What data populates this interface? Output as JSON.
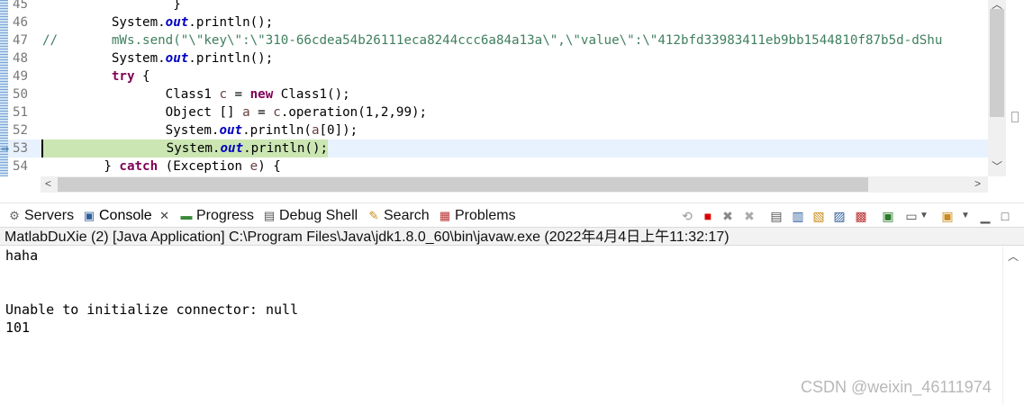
{
  "editor": {
    "lines": [
      {
        "num": "45",
        "segments": [
          {
            "t": "                 }",
            "c": ""
          }
        ]
      },
      {
        "num": "46",
        "segments": [
          {
            "t": "         System.",
            "c": ""
          },
          {
            "t": "out",
            "c": "fld"
          },
          {
            "t": ".println();",
            "c": ""
          }
        ]
      },
      {
        "num": "47",
        "segments": [
          {
            "t": "//       mWs.send(\"\\\"key\\\":\\\"310-66cdea54b26111eca8244ccc6a84a13a\\\",\\\"value\\\":\\\"412bfd33983411eb9bb1544810f87b5d-dShu",
            "c": "cm"
          }
        ]
      },
      {
        "num": "48",
        "segments": [
          {
            "t": "         System.",
            "c": ""
          },
          {
            "t": "out",
            "c": "fld"
          },
          {
            "t": ".println();",
            "c": ""
          }
        ]
      },
      {
        "num": "49",
        "segments": [
          {
            "t": "         ",
            "c": ""
          },
          {
            "t": "try",
            "c": "kw"
          },
          {
            "t": " {",
            "c": ""
          }
        ]
      },
      {
        "num": "50",
        "segments": [
          {
            "t": "                Class1 ",
            "c": ""
          },
          {
            "t": "c",
            "c": "var"
          },
          {
            "t": " = ",
            "c": ""
          },
          {
            "t": "new",
            "c": "kw"
          },
          {
            "t": " Class1();",
            "c": ""
          }
        ]
      },
      {
        "num": "51",
        "segments": [
          {
            "t": "                Object [] ",
            "c": ""
          },
          {
            "t": "a",
            "c": "var"
          },
          {
            "t": " = ",
            "c": ""
          },
          {
            "t": "c",
            "c": "var"
          },
          {
            "t": ".operation(1,2,99);",
            "c": ""
          }
        ]
      },
      {
        "num": "52",
        "segments": [
          {
            "t": "                System.",
            "c": ""
          },
          {
            "t": "out",
            "c": "fld"
          },
          {
            "t": ".println(",
            "c": ""
          },
          {
            "t": "a",
            "c": "var"
          },
          {
            "t": "[0]);",
            "c": ""
          }
        ]
      },
      {
        "num": "53",
        "current": true,
        "segments": [
          {
            "t": "                System.",
            "c": ""
          },
          {
            "t": "out",
            "c": "fld"
          },
          {
            "t": ".println();",
            "c": ""
          }
        ]
      },
      {
        "num": "54",
        "segments": [
          {
            "t": "        } ",
            "c": ""
          },
          {
            "t": "catch",
            "c": "kw"
          },
          {
            "t": " (Exception ",
            "c": ""
          },
          {
            "t": "e",
            "c": "var"
          },
          {
            "t": ") {",
            "c": ""
          }
        ]
      }
    ]
  },
  "tabs": [
    {
      "label": "Servers",
      "icon": "servers-icon",
      "glyph": "⚙"
    },
    {
      "label": "Console",
      "icon": "console-icon",
      "glyph": "▣",
      "active": true,
      "closable": true
    },
    {
      "label": "Progress",
      "icon": "progress-icon",
      "glyph": "▬"
    },
    {
      "label": "Debug Shell",
      "icon": "debug-shell-icon",
      "glyph": "▤"
    },
    {
      "label": "Search",
      "icon": "search-icon",
      "glyph": "✎"
    },
    {
      "label": "Problems",
      "icon": "problems-icon",
      "glyph": "▦"
    }
  ],
  "console": {
    "description": "MatlabDuXie (2) [Java Application] C:\\Program Files\\Java\\jdk1.8.0_60\\bin\\javaw.exe  (2022年4月4日上午11:32:17)",
    "output": [
      "haha",
      "",
      "",
      "Unable to initialize connector: null",
      "101"
    ]
  },
  "watermark": "CSDN @weixin_46111974",
  "colors": {
    "keyword": "#7f0055",
    "field": "#0000c0",
    "comment": "#3f7f5f",
    "current_line": "#cce6b3",
    "line_highlight": "#e8f2fe"
  }
}
